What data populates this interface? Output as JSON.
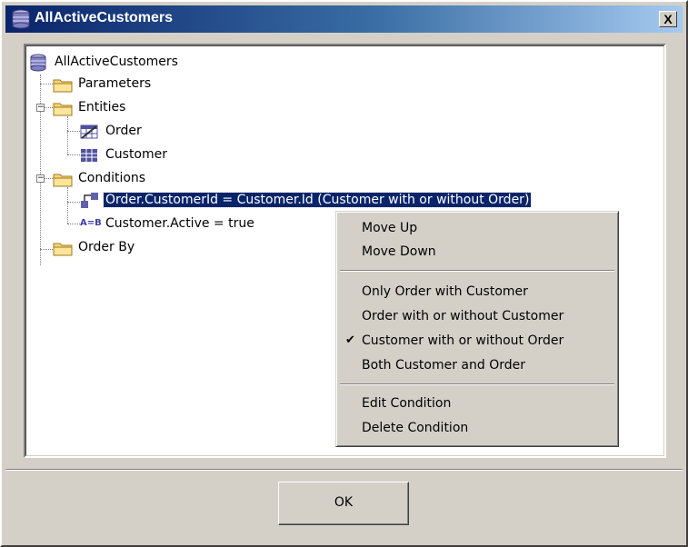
{
  "window": {
    "title": "AllActiveCustomers",
    "close_label": "X"
  },
  "tree": {
    "root": "AllActiveCustomers",
    "parameters": "Parameters",
    "entities": "Entities",
    "entity_order": "Order",
    "entity_customer": "Customer",
    "conditions": "Conditions",
    "condition_join": "Order.CustomerId = Customer.Id  (Customer with or without Order)",
    "condition_active": "Customer.Active = true",
    "condition_active_icon_text": "A=B",
    "order_by": "Order By"
  },
  "context_menu": {
    "move_up": "Move Up",
    "move_down": "Move Down",
    "only_order_with_customer": "Only Order with Customer",
    "order_with_or_without_customer": "Order with or without Customer",
    "customer_with_or_without_order": "Customer with or without Order",
    "checked_item": "customer_with_or_without_order",
    "both_customer_and_order": "Both Customer and Order",
    "edit_condition": "Edit Condition",
    "delete_condition": "Delete Condition"
  },
  "buttons": {
    "ok": "OK"
  },
  "colors": {
    "title_gradient_start": "#0a246a",
    "title_gradient_end": "#a6caf0",
    "selection": "#0a246a",
    "face": "#d4d0c8"
  }
}
